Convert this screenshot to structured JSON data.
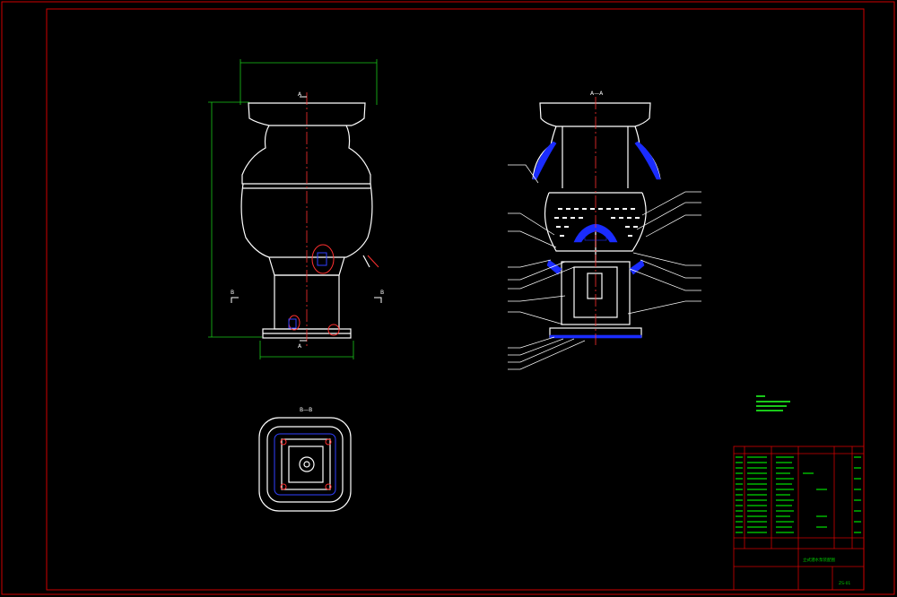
{
  "drawing": {
    "colors": {
      "background": "#000000",
      "frame": "#d00000",
      "outline": "#ffffff",
      "centerline": "#ff3030",
      "dimension": "#19c819",
      "hatch": "#1a2cff",
      "leader": "#ffffff",
      "table_text": "#00cc00"
    },
    "views": {
      "front": {
        "section_mark_top": "A",
        "section_mark_bottom": "A",
        "section_mark_left": "B",
        "section_mark_right": "B"
      },
      "section_aa": {
        "title": "A—A"
      },
      "section_bb": {
        "title": "B—B"
      }
    },
    "title_block": {
      "drawing_name": "立式潜水泵装配图",
      "drawing_no": "ZS-01"
    }
  }
}
